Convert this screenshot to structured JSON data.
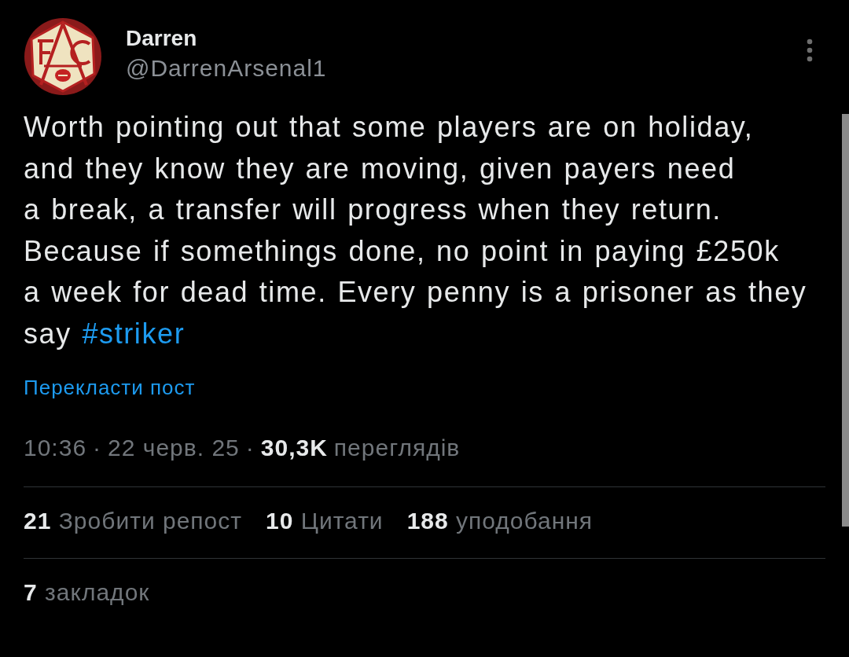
{
  "author": {
    "name": "Darren",
    "handle": "@DarrenArsenal1"
  },
  "post": {
    "text": "Worth pointing out that some players are on holiday,\nand they know they are moving, given payers need\na break, a transfer will progress when they return.\nBecause if somethings done, no point in paying £250k\na week for dead time. Every penny is a prisoner as they\nsay",
    "hashtag": "#striker"
  },
  "translate_link": "Перекласти пост",
  "meta": {
    "separator": "·",
    "time": "10:36",
    "date": "22 черв. 25",
    "views_count": "30,3K",
    "views_label": "переглядів"
  },
  "stats": [
    {
      "count": "21",
      "label": "Зробити репост"
    },
    {
      "count": "10",
      "label": "Цитати"
    },
    {
      "count": "188",
      "label": "уподобання"
    }
  ],
  "bookmarks": {
    "count": "7",
    "label": "закладок"
  }
}
